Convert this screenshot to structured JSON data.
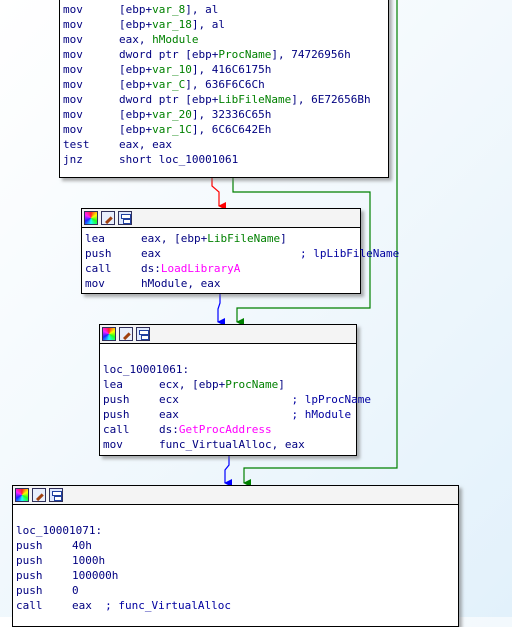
{
  "blocks": [
    {
      "lines": [
        {
          "mnemonic": "mov",
          "pre": "[ebp+",
          "sym": "var_8",
          "post": "], al"
        },
        {
          "mnemonic": "mov",
          "pre": "[ebp+",
          "sym": "var_18",
          "post": "], al"
        },
        {
          "mnemonic": "mov",
          "pre": "eax, ",
          "sym": "hModule",
          "post": ""
        },
        {
          "mnemonic": "mov",
          "pre": "dword ptr [ebp+",
          "sym": "ProcName",
          "post": "], 74726956h"
        },
        {
          "mnemonic": "mov",
          "pre": "[ebp+",
          "sym": "var_10",
          "post": "], 416C6175h"
        },
        {
          "mnemonic": "mov",
          "pre": "[ebp+",
          "sym": "var_C",
          "post": "], 636F6C6Ch"
        },
        {
          "mnemonic": "mov",
          "pre": "dword ptr [ebp+",
          "sym": "LibFileName",
          "post": "], 6E72656Bh"
        },
        {
          "mnemonic": "mov",
          "pre": "[ebp+",
          "sym": "var_20",
          "post": "], 32336C65h"
        },
        {
          "mnemonic": "mov",
          "pre": "[ebp+",
          "sym": "var_1C",
          "post": "], 6C6C642Eh"
        },
        {
          "mnemonic": "test",
          "pre": "eax, eax",
          "sym": "",
          "post": ""
        },
        {
          "mnemonic": "jnz",
          "pre": "short loc_10001061",
          "sym": "",
          "post": ""
        }
      ]
    },
    {
      "lines": [
        {
          "mnemonic": "lea",
          "pre": "eax, [ebp+",
          "sym": "LibFileName",
          "post": "]"
        },
        {
          "mnemonic": "push",
          "pre": "eax",
          "sym": "",
          "post": "",
          "comment": "; lpLibFileName"
        },
        {
          "mnemonic": "call",
          "pre": "ds:",
          "sym": "",
          "post": "",
          "import": "LoadLibraryA"
        },
        {
          "mnemonic": "mov",
          "pre": "hModule, eax",
          "sym": "",
          "post": ""
        }
      ]
    },
    {
      "label": "loc_10001061:",
      "lines": [
        {
          "mnemonic": "lea",
          "pre": "ecx, [ebp+",
          "sym": "ProcName",
          "post": "]"
        },
        {
          "mnemonic": "push",
          "pre": "ecx",
          "sym": "",
          "post": "",
          "comment": "; lpProcName"
        },
        {
          "mnemonic": "push",
          "pre": "eax",
          "sym": "",
          "post": "",
          "comment": "; hModule"
        },
        {
          "mnemonic": "call",
          "pre": "ds:",
          "sym": "",
          "post": "",
          "import": "GetProcAddress"
        },
        {
          "mnemonic": "mov",
          "pre": "func_VirtualAlloc, eax",
          "sym": "",
          "post": ""
        }
      ]
    },
    {
      "label": "loc_10001071:",
      "lines": [
        {
          "mnemonic": "push",
          "pre": "40h",
          "sym": "",
          "post": ""
        },
        {
          "mnemonic": "push",
          "pre": "1000h",
          "sym": "",
          "post": ""
        },
        {
          "mnemonic": "push",
          "pre": "100000h",
          "sym": "",
          "post": ""
        },
        {
          "mnemonic": "push",
          "pre": "0",
          "sym": "",
          "post": ""
        },
        {
          "mnemonic": "call",
          "pre": "eax ",
          "sym": "",
          "post": "",
          "comment": "; func_VirtualAlloc"
        }
      ]
    }
  ],
  "edge_colors": {
    "false_branch": "#ff0000",
    "true_branch": "#008000",
    "unconditional": "#0000ff"
  },
  "icons": [
    "color-palette-icon",
    "rename-icon",
    "graph-overview-icon"
  ]
}
